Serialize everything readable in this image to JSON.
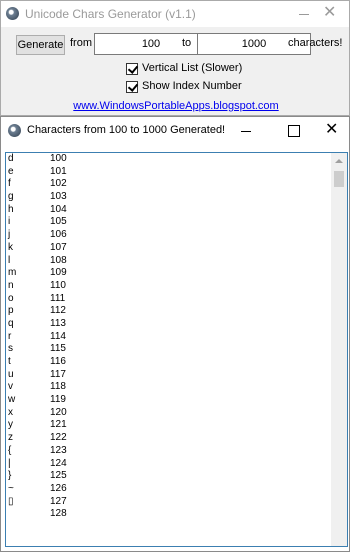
{
  "generator": {
    "title": "Unicode Chars Generator (v1.1)",
    "generate_label": "Generate",
    "from_label": "from",
    "from_value": "100",
    "to_label": "to",
    "to_value": "1000",
    "suffix_label": "characters!",
    "vertical_list_label": "Vertical List (Slower)",
    "vertical_list_checked": true,
    "show_index_label": "Show Index Number",
    "show_index_checked": true,
    "link_text": "www.WindowsPortableApps.blogspot.com"
  },
  "results": {
    "title": "Characters from 100 to 1000 Generated!",
    "rows": [
      {
        "char": "d",
        "index": "100"
      },
      {
        "char": "e",
        "index": "101"
      },
      {
        "char": "f",
        "index": "102"
      },
      {
        "char": "g",
        "index": "103"
      },
      {
        "char": "h",
        "index": "104"
      },
      {
        "char": "i",
        "index": "105"
      },
      {
        "char": "j",
        "index": "106"
      },
      {
        "char": "k",
        "index": "107"
      },
      {
        "char": "l",
        "index": "108"
      },
      {
        "char": "m",
        "index": "109"
      },
      {
        "char": "n",
        "index": "110"
      },
      {
        "char": "o",
        "index": "111"
      },
      {
        "char": "p",
        "index": "112"
      },
      {
        "char": "q",
        "index": "113"
      },
      {
        "char": "r",
        "index": "114"
      },
      {
        "char": "s",
        "index": "115"
      },
      {
        "char": "t",
        "index": "116"
      },
      {
        "char": "u",
        "index": "117"
      },
      {
        "char": "v",
        "index": "118"
      },
      {
        "char": "w",
        "index": "119"
      },
      {
        "char": "x",
        "index": "120"
      },
      {
        "char": "y",
        "index": "121"
      },
      {
        "char": "z",
        "index": "122"
      },
      {
        "char": "{",
        "index": "123"
      },
      {
        "char": "|",
        "index": "124"
      },
      {
        "char": "}",
        "index": "125"
      },
      {
        "char": "~",
        "index": "126"
      },
      {
        "char": "▯",
        "index": "127"
      },
      {
        "char": "",
        "index": "128"
      }
    ]
  }
}
